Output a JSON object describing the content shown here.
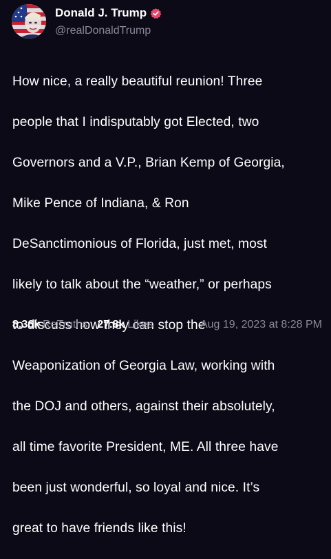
{
  "author": {
    "display_name": "Donald J. Trump",
    "handle": "@realDonaldTrump",
    "verified": true,
    "verified_color": "#e8476c"
  },
  "post": {
    "text": "How nice, a really beautiful reunion! Three people that I indisputably got Elected, two Governors and a V.P., Brian Kemp of Georgia, Mike Pence of Indiana, & Ron DeSanctimonious of Florida, just met, most likely to talk about the “weather,” or perhaps to discuss how they can stop the Weaponization of Georgia Law, working with the DOJ and others, against their absolutely, all time favorite President, ME. All three have been just wonderful, so loyal and nice. It’s great to have friends like this!",
    "lines": [
      "How nice, a really beautiful reunion! Three",
      "people that I indisputably got Elected, two",
      "Governors and a V.P., Brian Kemp of Georgia,",
      "Mike Pence of Indiana, & Ron",
      "DeSanctimonious of Florida, just met, most",
      "likely to talk about the “weather,” or perhaps",
      "to discuss how they can stop the",
      "Weaponization of Georgia Law, working with",
      "the DOJ and others, against their absolutely,",
      "all time favorite President, ME. All three have",
      "been just wonderful, so loyal and nice. It’s",
      "great to have friends like this!"
    ]
  },
  "stats": {
    "retruths_count": "8.36k",
    "retruths_label": "ReTruths",
    "likes_count": "27.8k",
    "likes_label": "Likes",
    "timestamp": "Aug 19, 2023 at 8:28 PM"
  },
  "colors": {
    "background": "#0b0a16",
    "text": "#ffffff",
    "muted": "#8a8a96"
  }
}
